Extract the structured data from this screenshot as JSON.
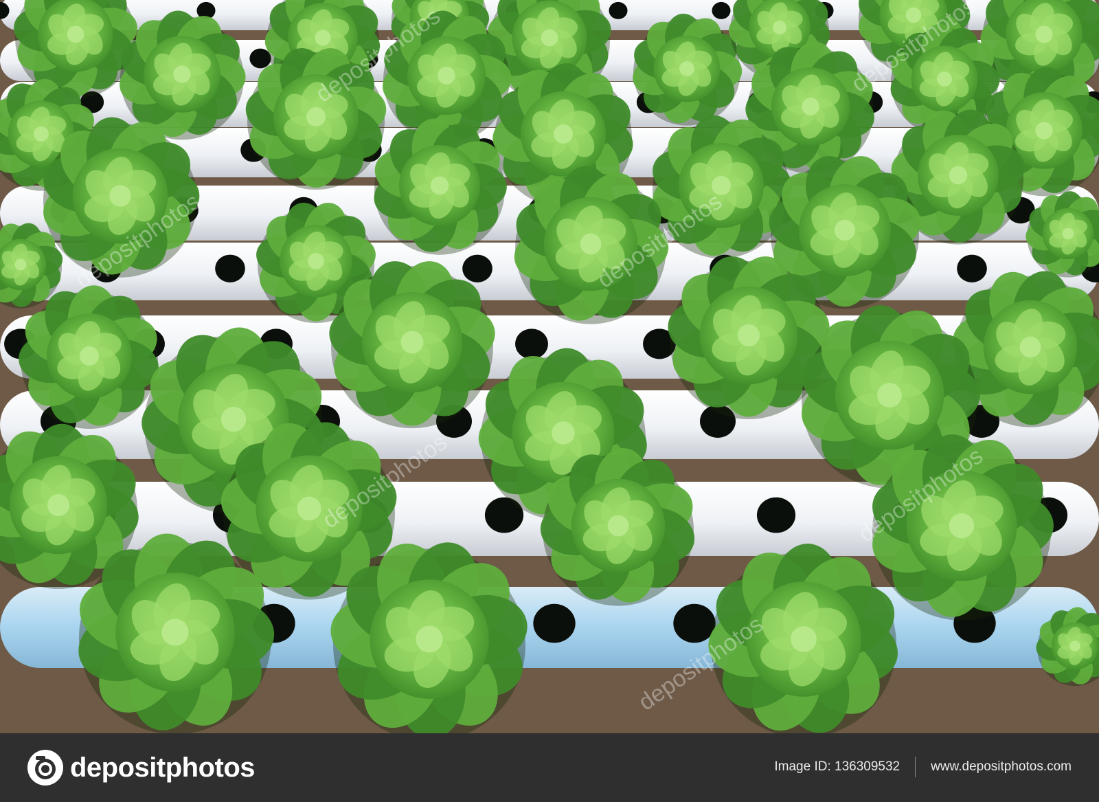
{
  "image": {
    "subject": "hydroponic lettuce",
    "colors": {
      "soil": "#6e5a47",
      "pipe": "#f1f3f6",
      "pipe_blue": "#a9d4ef",
      "hole": "#0b0f0b",
      "leaf_dark": "#3f8b2a",
      "leaf_mid": "#5fae3c",
      "leaf_light": "#9ddb6b",
      "footer_bg": "#2f2f2f"
    },
    "watermark": "depositphotos"
  },
  "footer": {
    "brand": "depositphotos",
    "image_id": "Image ID: 136309532",
    "site": "www.depositphotos.com"
  }
}
